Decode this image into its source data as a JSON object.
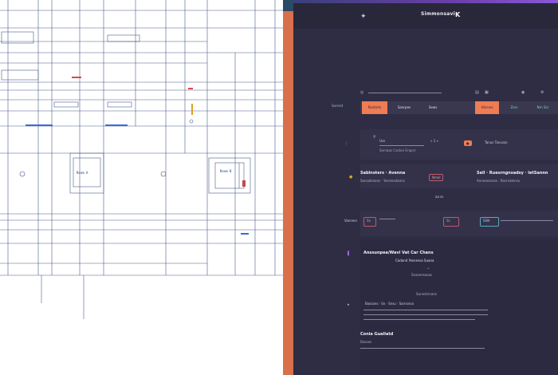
{
  "blueprint": {
    "room_label_a": "Room A",
    "room_label_b": "Room B"
  },
  "header": {
    "title": "Simmonsavi",
    "logo_glyph": "K"
  },
  "toolbar": {
    "icons": [
      "wand-icon",
      "list-icon",
      "cart-icon",
      "help-icon"
    ]
  },
  "tabs": {
    "left_label": "Sorrest",
    "items": [
      "Restarts",
      "Sanrpes",
      "Sews",
      "Hisrnes",
      "Zors",
      "Nrn Ssr"
    ]
  },
  "filters": {
    "label": "Uss",
    "range_text": "Sorrwas Caston Eraprn",
    "pager": "« 1 »",
    "right_text": "Tanus Tanusas"
  },
  "listing_a": {
    "title": "Sablnsters · Avenna",
    "sub": "Sansalenans · Yanrenstanns",
    "badge": "Nmel"
  },
  "listing_b": {
    "title": "Sell · Ruesrngnsadsy · letSannn",
    "sub": "Anneassnoss · Resrnalensn"
  },
  "listing_pager": "aa ss",
  "thumbs": {
    "label": "Vanners",
    "items": [
      "Sn",
      "Ss",
      "SSN"
    ]
  },
  "detail": {
    "title": "Anssunpea/Wavi Vat Car Chans",
    "subtitle": "Cadand Yesnessa Suana",
    "note": "Snanereanas",
    "divider_label": "Sunnstnnans",
    "meta": "Bassans · Sn · Snsu · Sarnsnsa",
    "footer_title": "Conia Guallatd",
    "footer_sub": "Dasses"
  }
}
